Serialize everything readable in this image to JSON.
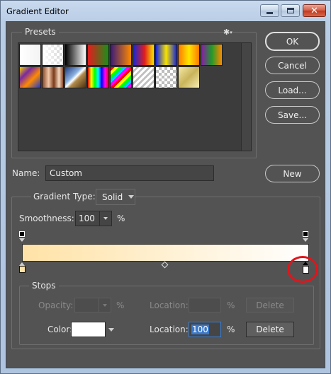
{
  "window": {
    "title": "Gradient Editor",
    "close_glyph": "✕"
  },
  "presets": {
    "title": "Presets",
    "menu_icon": "gear-icon",
    "swatches": [
      {
        "name": "foreground-to-background",
        "bg": "linear-gradient(90deg,#ffffff,#f3f3f3)"
      },
      {
        "name": "foreground-to-transparent",
        "bg": "linear-gradient(90deg,#ffffff 0%,rgba(255,255,255,0.1) 100%), repeating-conic-gradient(#cfcfcf 0% 25%, #ffffff 0% 50%) 0 0/8px 8px"
      },
      {
        "name": "black-white",
        "bg": "linear-gradient(90deg,#000,#fff)"
      },
      {
        "name": "red-green",
        "bg": "linear-gradient(90deg,#e21d1d,#1b8f1b)"
      },
      {
        "name": "violet-orange",
        "bg": "linear-gradient(90deg,#3a1a78,#ff8a00)"
      },
      {
        "name": "blue-red-yellow",
        "bg": "linear-gradient(90deg,#1726d8,#e21d1d 55%,#f7e300)"
      },
      {
        "name": "blue-yellow-blue",
        "bg": "linear-gradient(90deg,#1726d8,#f7e300 50%,#1726d8)"
      },
      {
        "name": "orange-yellow-orange",
        "bg": "linear-gradient(90deg,#ff7a00,#ffe600 50%,#ff7a00)"
      },
      {
        "name": "violet-green-orange",
        "bg": "linear-gradient(90deg,#8a1aa8,#1f9a2a 50%,#ff8a00)"
      },
      {
        "name": "yellow-violet-orange-blue",
        "bg": "linear-gradient(135deg,#f2d000 0%,#7a2aa0 30%,#ff8a00 60%,#1a3ad0 100%)"
      },
      {
        "name": "copper",
        "bg": "linear-gradient(90deg,#8a4a2a,#f2c8a8 30%,#7a3a1a 55%,#f5d8c0 80%,#8a4a2a)"
      },
      {
        "name": "chrome",
        "bg": "linear-gradient(135deg,#1f3a7a 0%,#8ab0e0 40%,#ffffff 50%,#b08a4a 60%,#4a3010 100%)"
      },
      {
        "name": "spectrum",
        "bg": "linear-gradient(90deg,#ff0000,#ffff00,#00ff00,#00ffff,#0000ff,#ff00ff,#ff0000)"
      },
      {
        "name": "transparent-rainbow",
        "bg": "repeating-linear-gradient(135deg,#ff0000 0 4px,#ffff00 4px 8px,#00ff00 8px 12px,#00ccff 12px 16px,#ff00ff 16px 20px)"
      },
      {
        "name": "transparent-stripes",
        "bg": "repeating-linear-gradient(135deg,#ffffff 0 3px,#c0c0c0 3px 6px)"
      },
      {
        "name": "neutral-density",
        "bg": "repeating-conic-gradient(#bdbdbd 0% 25%, #ffffff 0% 50%) 0 0/8px 8px"
      },
      {
        "name": "gold",
        "bg": "linear-gradient(135deg,#f5e9a8,#c9b45a 50%,#f7eeb5)"
      }
    ]
  },
  "buttons": {
    "ok": "OK",
    "cancel": "Cancel",
    "load": "Load...",
    "save": "Save...",
    "new": "New"
  },
  "name_field": {
    "label": "Name:",
    "value": "Custom"
  },
  "gradient": {
    "group_title": "",
    "type_label": "Gradient Type:",
    "type_value": "Solid",
    "smoothness_label": "Smoothness:",
    "smoothness_value": "100",
    "smoothness_unit": "%",
    "colors": {
      "start": "#ffe2a6",
      "end": "#ffffff"
    }
  },
  "stops": {
    "title": "Stops",
    "opacity_label": "Opacity:",
    "opacity_value": "",
    "opacity_unit": "%",
    "opacity_location_label": "Location:",
    "opacity_location_value": "",
    "opacity_location_unit": "%",
    "opacity_delete": "Delete",
    "color_label": "Color:",
    "color_value": "#ffffff",
    "color_location_label": "Location:",
    "color_location_value": "100",
    "color_location_unit": "%",
    "color_delete": "Delete"
  },
  "annotation": {
    "color": "#e3141a"
  }
}
